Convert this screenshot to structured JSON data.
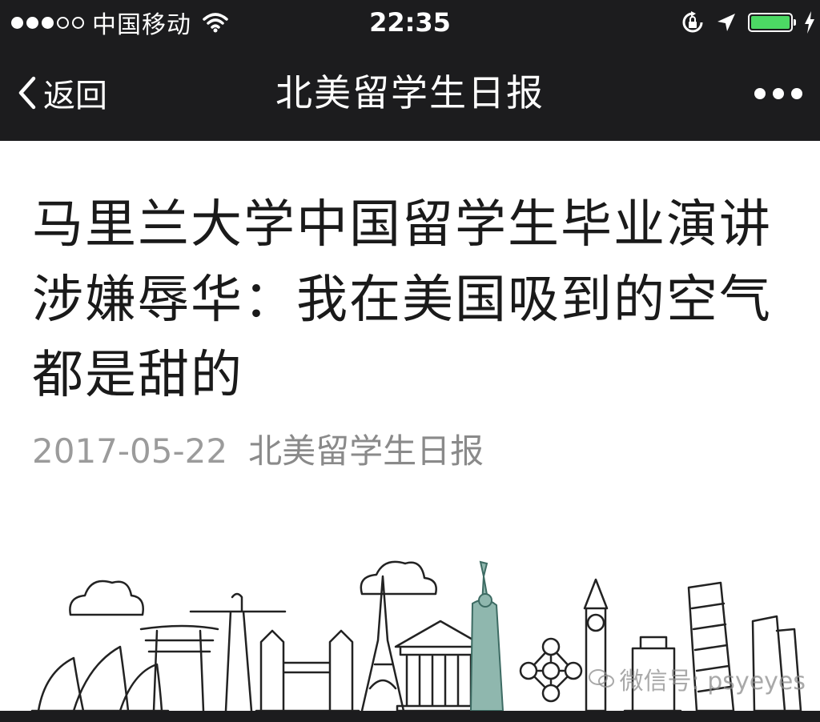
{
  "status_bar": {
    "signal_dots": [
      true,
      true,
      true,
      false,
      false
    ],
    "carrier": "中国移动",
    "time": "22:35",
    "battery_level": 1.0,
    "icons": [
      "wifi-icon",
      "orientation-lock-icon",
      "location-arrow-icon",
      "battery-icon",
      "charging-bolt-icon"
    ]
  },
  "nav": {
    "back_label": "返回",
    "title": "北美留学生日报",
    "more_icon": "more-dots-icon"
  },
  "article": {
    "title": "马里兰大学中国留学生毕业演讲涉嫌辱华：我在美国吸到的空气都是甜的",
    "date": "2017-05-22",
    "account": "北美留学生日报"
  },
  "watermark": {
    "text": "微信号: psyeyes"
  },
  "colors": {
    "bar_background": "#1c1c1e",
    "battery_fill": "#4cd964",
    "meta_text": "#9b9b9b",
    "liberty_teal": "#8fb7ae"
  }
}
